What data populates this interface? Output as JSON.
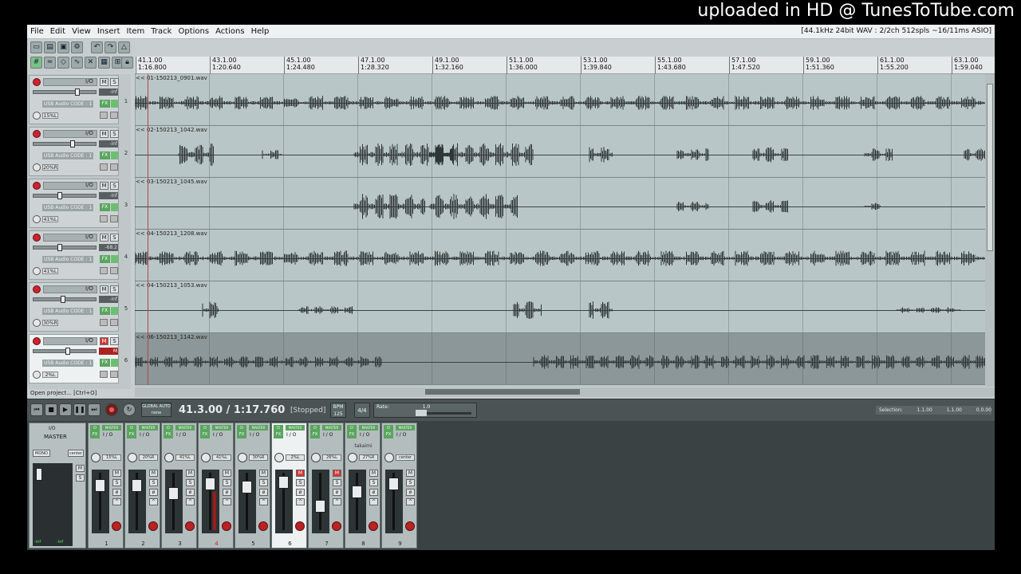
{
  "watermark": "uploaded in HD @ TunesToTube.com",
  "menu": {
    "items": [
      "File",
      "Edit",
      "View",
      "Insert",
      "Item",
      "Track",
      "Options",
      "Actions",
      "Help"
    ],
    "info": "[44.1kHz 24bit WAV : 2/2ch 512spls ~16/11ms ASIO]"
  },
  "ruler": [
    {
      "bar": "41.1.00",
      "time": "1:16.800"
    },
    {
      "bar": "43.1.00",
      "time": "1:20.640"
    },
    {
      "bar": "45.1.00",
      "time": "1:24.480"
    },
    {
      "bar": "47.1.00",
      "time": "1:28.320"
    },
    {
      "bar": "49.1.00",
      "time": "1:32.160"
    },
    {
      "bar": "51.1.00",
      "time": "1:36.000"
    },
    {
      "bar": "53.1.00",
      "time": "1:39.840"
    },
    {
      "bar": "55.1.00",
      "time": "1:43.680"
    },
    {
      "bar": "57.1.00",
      "time": "1:47.520"
    },
    {
      "bar": "59.1.00",
      "time": "1:51.360"
    },
    {
      "bar": "61.1.00",
      "time": "1:55.200"
    },
    {
      "bar": "63.1.00",
      "time": "1:59.040"
    }
  ],
  "tracks": [
    {
      "num": "1",
      "item": "<< 01-150213_0901.wav",
      "vol": "-inf",
      "input": "USB Audio CODE : 1",
      "pan": "15%L",
      "muted": false
    },
    {
      "num": "2",
      "item": "<< 02-150213_1042.wav",
      "vol": "-inf",
      "input": "USB Audio CODE : 1",
      "pan": "20%R",
      "muted": false
    },
    {
      "num": "3",
      "item": "<< 03-150213_1045.wav",
      "vol": "-inf",
      "input": "USB Audio CODE : 1",
      "pan": "41%L",
      "muted": false
    },
    {
      "num": "4",
      "item": "<< 04-150213_1208.wav",
      "vol": "-68.2",
      "input": "USB Audio CODE : 1",
      "pan": "41%L",
      "muted": false
    },
    {
      "num": "5",
      "item": "<< 04-150213_1053.wav",
      "vol": "-inf",
      "input": "USB Audio CODE : 1",
      "pan": "30%R",
      "muted": false
    },
    {
      "num": "6",
      "item": "<< 06-150213_1142.wav",
      "vol": "M",
      "input": "USB Audio CODE : 1",
      "pan": "2%L",
      "muted": true
    }
  ],
  "partial_track_label": "<< 06-150213_1142.wav",
  "status_left": "Open project... [Ctrl+O]",
  "transport": {
    "auto_label": "GLOBAL AUTO",
    "auto_value": "none",
    "time": "41.3.00 / 1:17.760",
    "state": "[Stopped]",
    "bpm_label": "BPM",
    "bpm": "125",
    "time_sig": "4/4",
    "rate_label": "Rate:",
    "rate_value": "1.0",
    "selection_label": "Selection:",
    "selection_start": "1.1.00",
    "selection_end": "1.1.00",
    "selection_len": "0.0.00"
  },
  "mixer": {
    "master_label": "MASTER",
    "master_io": "I/O",
    "mono": "MONO",
    "center": "center",
    "master_peak_l": "-inf",
    "master_peak_r": "-inf",
    "strips": [
      {
        "num": "1",
        "pan": "15%L",
        "name": "",
        "mast": "MASTER",
        "muted": false
      },
      {
        "num": "2",
        "pan": "20%R",
        "name": "",
        "mast": "MASTER",
        "muted": false
      },
      {
        "num": "3",
        "pan": "41%L",
        "name": "",
        "mast": "MASTER",
        "muted": false
      },
      {
        "num": "4",
        "pan": "41%L",
        "name": "",
        "mast": "MASTER",
        "muted": false
      },
      {
        "num": "5",
        "pan": "30%R",
        "name": "",
        "mast": "MASTER",
        "muted": false
      },
      {
        "num": "6",
        "pan": "2%L",
        "name": "",
        "mast": "MASTER",
        "muted": true
      },
      {
        "num": "7",
        "pan": "26%L",
        "name": "",
        "mast": "MASTER",
        "muted": true
      },
      {
        "num": "8",
        "pan": "27%R",
        "name": "takaimi",
        "mast": "MASTER",
        "muted": false
      },
      {
        "num": "9",
        "pan": "center",
        "name": "",
        "mast": "MASTER",
        "muted": false
      }
    ]
  },
  "colors": {
    "accent_green": "#5aa55f",
    "mute_red": "#d63333",
    "arrange_bg": "#b9c6c7"
  }
}
